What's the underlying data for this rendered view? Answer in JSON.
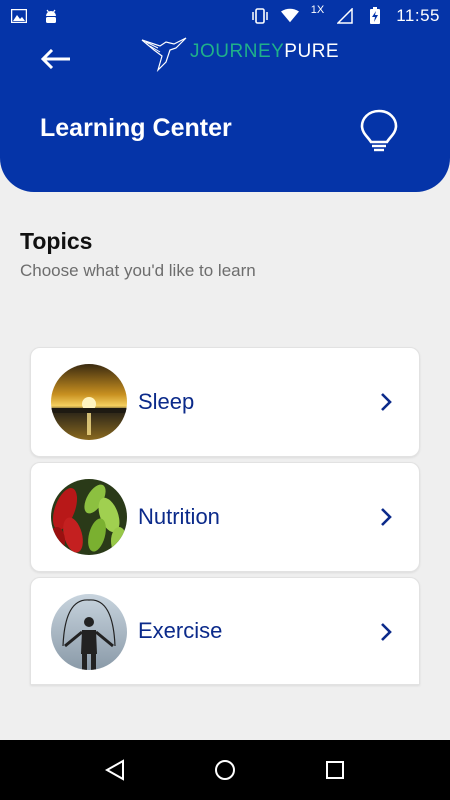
{
  "status_bar": {
    "time": "11:55",
    "network_badge": "1X",
    "icons": [
      "image-icon",
      "android-icon",
      "vibrate-icon",
      "wifi-icon",
      "signal-icon",
      "battery-charging-icon"
    ]
  },
  "header": {
    "logo_part1": "JOURNEY",
    "logo_part2": "PURE",
    "title": "Learning Center",
    "back_icon": "back-arrow-icon",
    "action_icon": "lightbulb-icon"
  },
  "topics": {
    "title": "Topics",
    "subtitle": "Choose what you'd like to learn",
    "items": [
      {
        "label": "Sleep",
        "image": "sunset-lake-image"
      },
      {
        "label": "Nutrition",
        "image": "peppers-image"
      },
      {
        "label": "Exercise",
        "image": "jump-rope-image"
      }
    ]
  },
  "nav_bar": {
    "icons": [
      "nav-back-icon",
      "nav-home-icon",
      "nav-recents-icon"
    ]
  },
  "colors": {
    "brand_blue": "#0534a8",
    "brand_green": "#1fb08a",
    "label_blue": "#0b2a8a",
    "background": "#efefef"
  }
}
